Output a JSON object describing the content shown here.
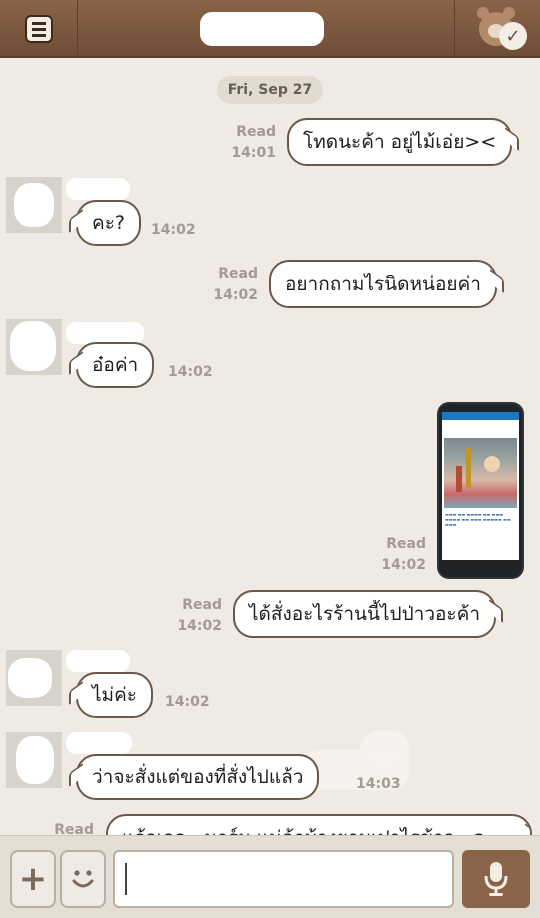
{
  "header": {
    "title": "",
    "menu_icon": "menu-icon",
    "friend_icon": "bear-check-icon"
  },
  "chat": {
    "date": "Fri, Sep 27",
    "messages": [
      {
        "direction": "out",
        "text": "โทดนะค้า อยู่ไม้เอ่ย><",
        "status": "Read",
        "time": "14:01"
      },
      {
        "direction": "in",
        "sender": "",
        "text": "คะ?",
        "time": "14:02"
      },
      {
        "direction": "out",
        "text": "อยากถามไรนิดหน่อยค่า",
        "status": "Read",
        "time": "14:02"
      },
      {
        "direction": "in",
        "sender": "",
        "text": "อ๋อค่า",
        "time": "14:02"
      },
      {
        "direction": "out",
        "type": "image",
        "status": "Read",
        "time": "14:02"
      },
      {
        "direction": "out",
        "text": "ได้สั่งอะไรร้านนี้ไปป่าวอะค้า",
        "status": "Read",
        "time": "14:02"
      },
      {
        "direction": "in",
        "sender": "",
        "text": "ไม่ค่ะ",
        "time": "14:02"
      },
      {
        "direction": "in",
        "sender": "",
        "text": "ว่าจะสั่งแต่ของที่สั่งไปแล้ว",
        "time": "14:03"
      },
      {
        "direction": "out",
        "text": "แล้วเอล...นาร์ม แม่ค้าบ้างยามเปาไรข้าว...ค",
        "status": "Read",
        "time": ""
      }
    ]
  },
  "input": {
    "plus_label": "+",
    "emoji_label": "☺",
    "placeholder": "",
    "value": ""
  }
}
